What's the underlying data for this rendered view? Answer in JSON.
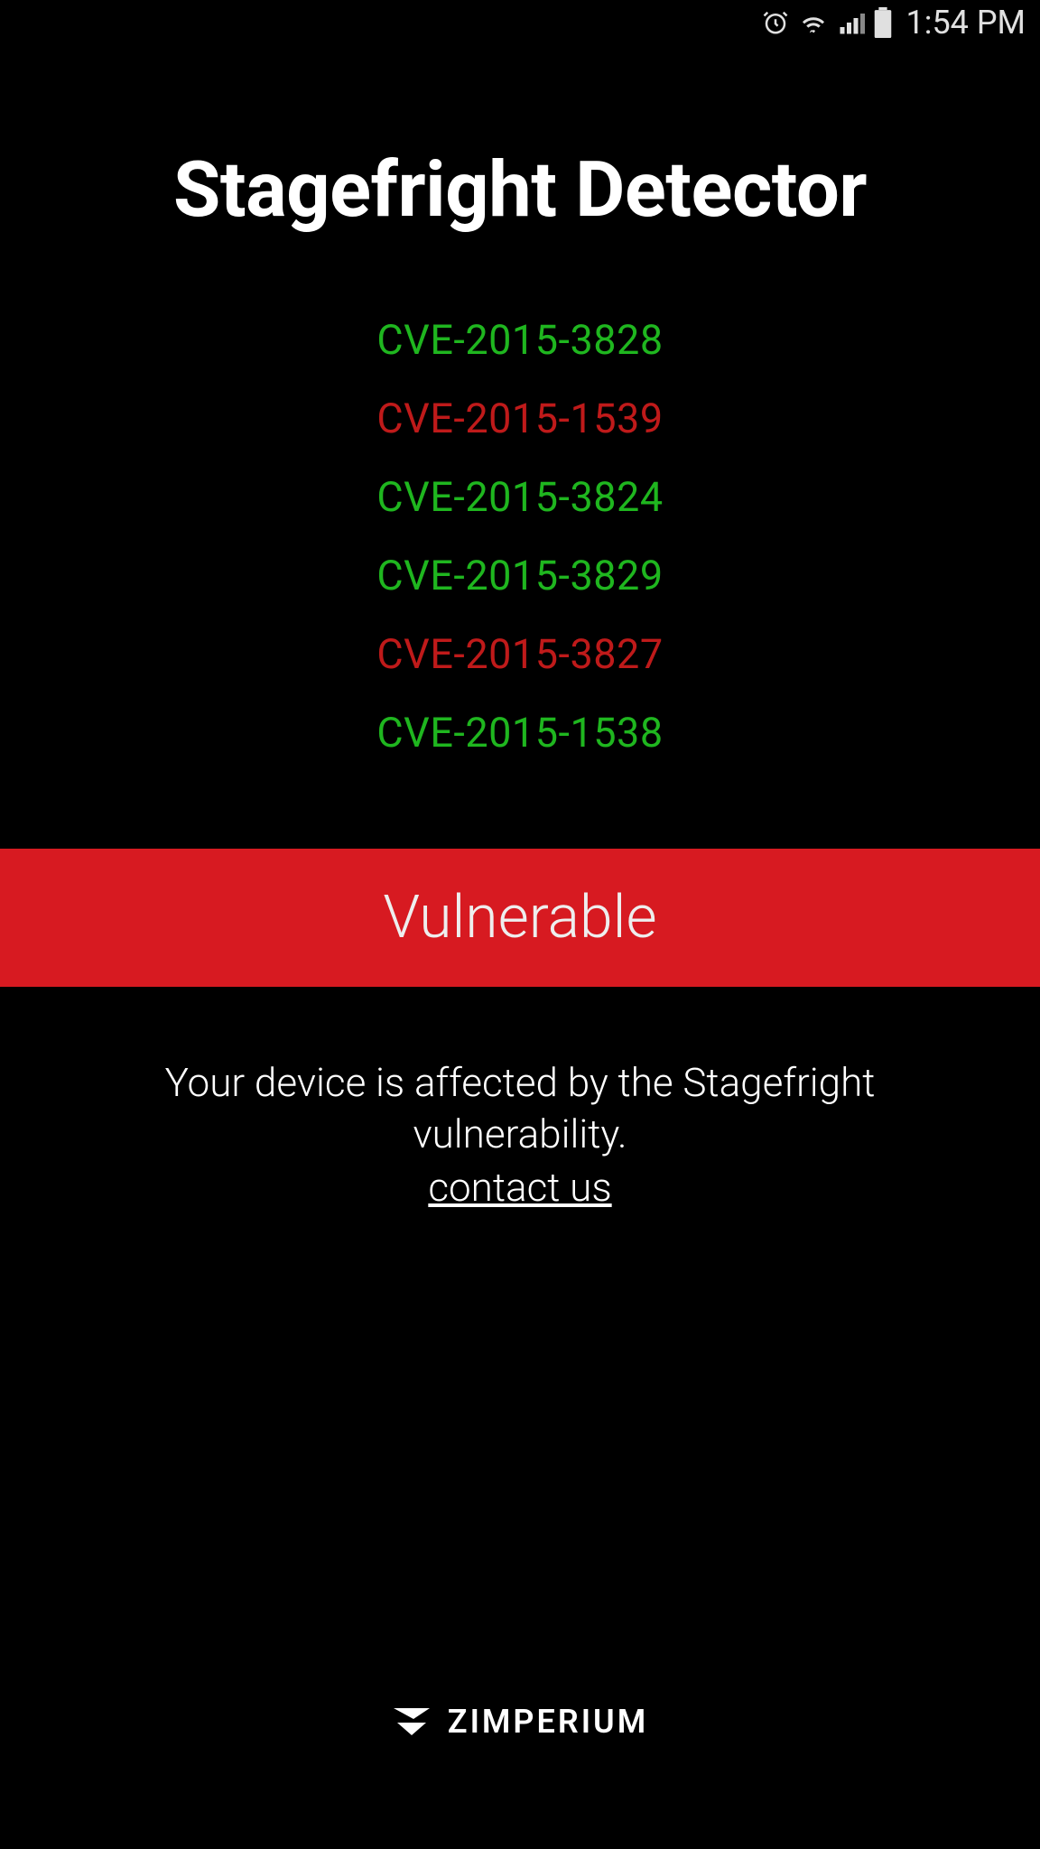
{
  "status_bar": {
    "time": "1:54 PM"
  },
  "app": {
    "title": "Stagefright Detector"
  },
  "cves": [
    {
      "id": "CVE-2015-3828",
      "vulnerable": false
    },
    {
      "id": "CVE-2015-1539",
      "vulnerable": true
    },
    {
      "id": "CVE-2015-3824",
      "vulnerable": false
    },
    {
      "id": "CVE-2015-3829",
      "vulnerable": false
    },
    {
      "id": "CVE-2015-3827",
      "vulnerable": true
    },
    {
      "id": "CVE-2015-1538",
      "vulnerable": false
    }
  ],
  "status_banner": {
    "label": "Vulnerable"
  },
  "message": {
    "text": "Your device is affected by the Stagefright vulnerability.",
    "contact_label": "contact us"
  },
  "footer": {
    "brand": "ZIMPERIUM"
  },
  "colors": {
    "safe": "#1fb61f",
    "vulnerable": "#bf1a1a",
    "banner": "#d71a21"
  }
}
